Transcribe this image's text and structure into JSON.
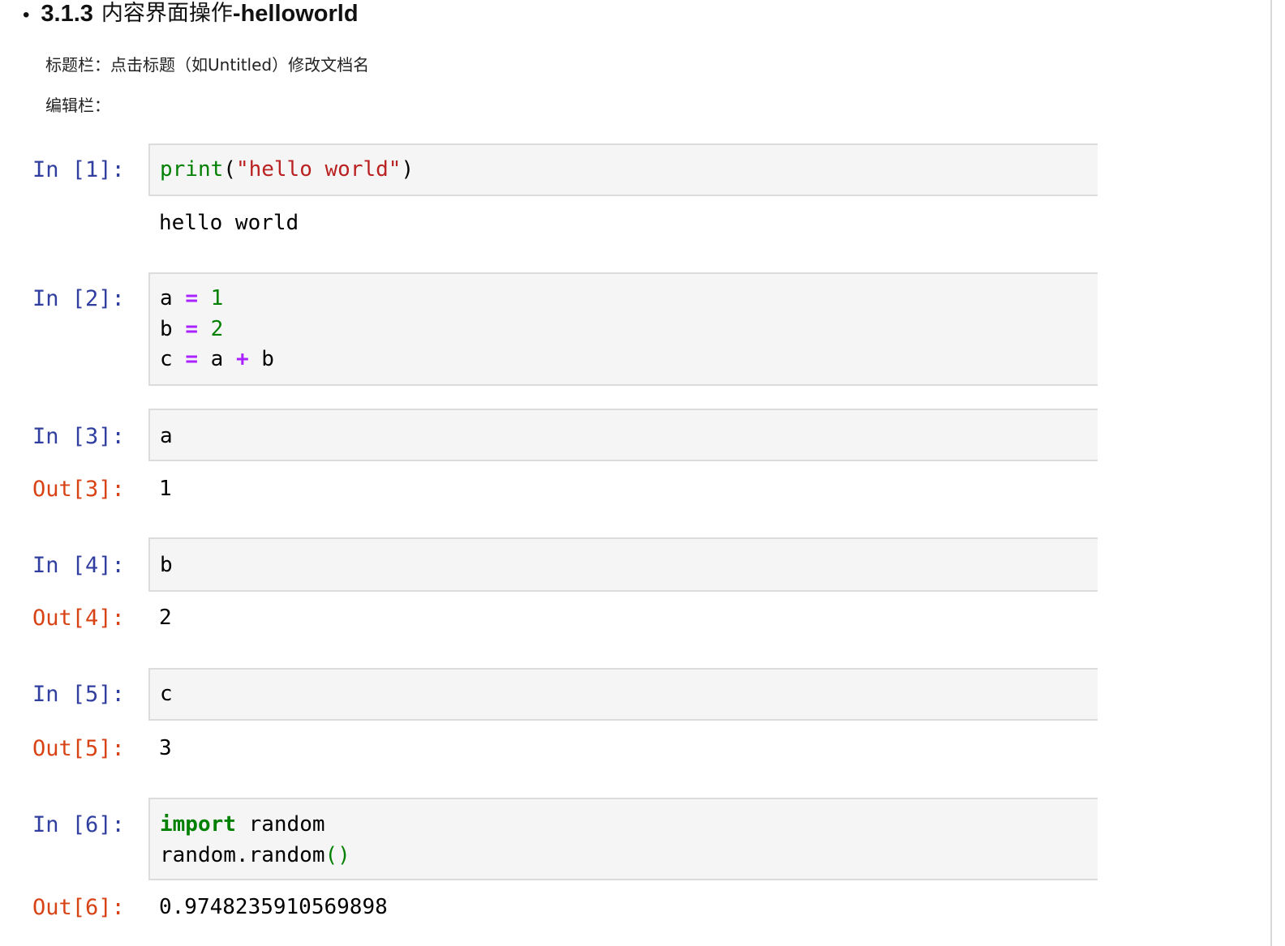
{
  "heading": {
    "bullet": "•",
    "number": "3.1.3",
    "title_cn": "内容界面操作",
    "title_en": "-helloworld"
  },
  "paragraphs": {
    "title_bar": "标题栏：点击标题（如Untitled）修改文档名",
    "edit_bar": "编辑栏："
  },
  "cells": [
    {
      "in_prompt": "In [1]:",
      "code": [
        "print(\"hello world\")"
      ],
      "stdout": "hello world"
    },
    {
      "in_prompt": "In [2]:",
      "code": [
        "a = 1",
        "b = 2",
        "c = a + b"
      ]
    },
    {
      "in_prompt": "In [3]:",
      "code": [
        "a"
      ],
      "out_prompt": "Out[3]:",
      "result": "1"
    },
    {
      "in_prompt": "In [4]:",
      "code": [
        "b"
      ],
      "out_prompt": "Out[4]:",
      "result": "2"
    },
    {
      "in_prompt": "In [5]:",
      "code": [
        "c"
      ],
      "out_prompt": "Out[5]:",
      "result": "3"
    },
    {
      "in_prompt": "In [6]:",
      "code": [
        "import random",
        "random.random()"
      ],
      "out_prompt": "Out[6]:",
      "result": "0.9748235910569898"
    }
  ],
  "colors": {
    "in_prompt": "#303f9f",
    "out_prompt": "#d84315",
    "keyword": "#008000",
    "string": "#ba2121",
    "operator": "#aa22ff",
    "cell_bg": "#f5f5f5",
    "cell_border": "#dcdcdc"
  }
}
